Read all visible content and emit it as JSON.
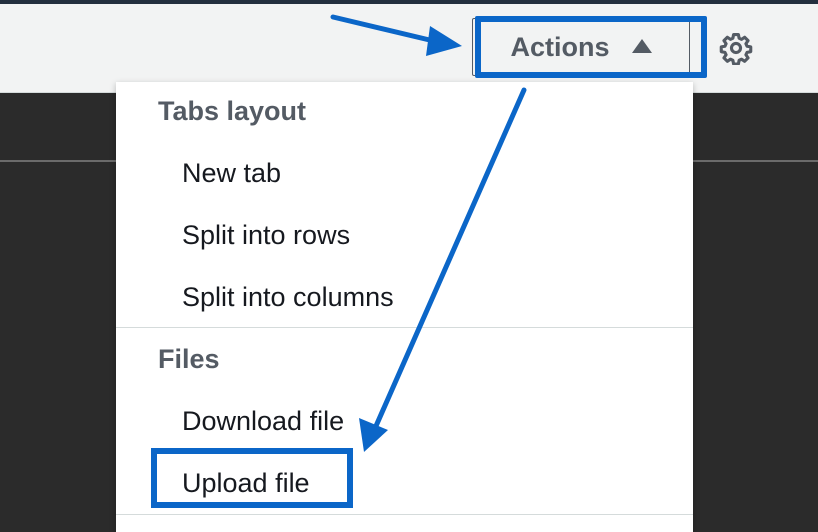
{
  "toolbar": {
    "actions_label": "Actions",
    "actions_state_icon": "caret-up-icon",
    "settings_icon": "gear-icon"
  },
  "menu": {
    "groups": [
      {
        "header": "Tabs layout",
        "items": [
          "New tab",
          "Split into rows",
          "Split into columns"
        ]
      },
      {
        "header": "Files",
        "items": [
          "Download file",
          "Upload file"
        ]
      }
    ]
  },
  "annotations": {
    "highlight_color": "#0b66c8",
    "highlighted_targets": [
      "Actions",
      "Upload file"
    ]
  },
  "colors": {
    "toolbar_bg": "#f2f3f3",
    "dark_bg": "#2b2b2b",
    "text_primary": "#16191f",
    "text_secondary": "#545b64"
  }
}
